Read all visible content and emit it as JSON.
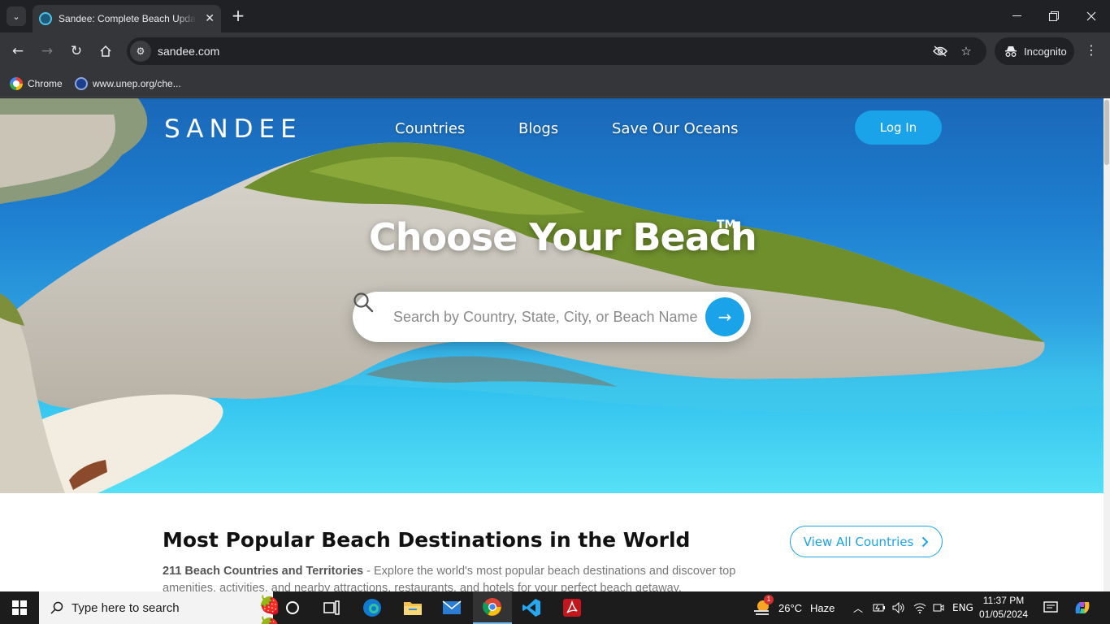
{
  "browser": {
    "tab_title": "Sandee: Complete Beach Update",
    "new_tab_symbol": "+",
    "url": "sandee.com",
    "incognito_label": "Incognito",
    "bookmarks": [
      {
        "label": "Chrome",
        "icon": "google-icon"
      },
      {
        "label": "www.unep.org/che...",
        "icon": "unep-icon"
      }
    ]
  },
  "site": {
    "logo": "SANDEE",
    "nav": {
      "countries": "Countries",
      "blogs": "Blogs",
      "save_oceans": "Save Our Oceans"
    },
    "login_label": "Log In",
    "hero": {
      "title": "Choose Your Beach",
      "trademark": "TM",
      "search_placeholder": "Search by Country, State, City, or Beach Name"
    },
    "popular": {
      "title": "Most Popular Beach Destinations in the World",
      "view_all_label": "View All Countries",
      "count_label": "211 Beach Countries and Territories",
      "description": " - Explore the world's most popular beach destinations and discover top amenities, activities, and nearby attractions, restaurants, and hotels for your perfect beach getaway."
    },
    "accent_color": "#1aa3e8"
  },
  "taskbar": {
    "search_placeholder": "Type here to search",
    "weather": {
      "temp": "26°C",
      "condition": "Haze",
      "alert_count": "1"
    },
    "language": "ENG",
    "time": "11:37 PM",
    "date": "01/05/2024"
  }
}
